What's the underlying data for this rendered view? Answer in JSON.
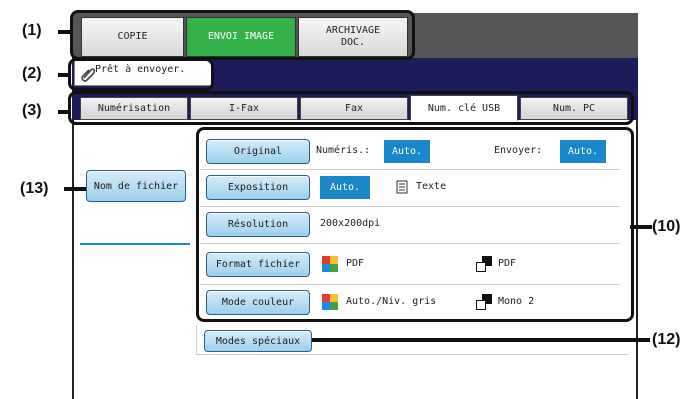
{
  "mode_tabs": [
    {
      "label": "COPIE"
    },
    {
      "label": "ENVOI IMAGE"
    },
    {
      "label": "ARCHIVAGE\nDOC."
    }
  ],
  "status": {
    "message": "Prêt à envoyer."
  },
  "sub_tabs": [
    {
      "label": "Numérisation"
    },
    {
      "label": "I-Fax"
    },
    {
      "label": "Fax"
    },
    {
      "label": "Num. clé USB"
    },
    {
      "label": "Num. PC"
    }
  ],
  "left": {
    "filename_button": "Nom de fichier"
  },
  "settings": {
    "original": {
      "button": "Original",
      "scan_label": "Numéris.:",
      "scan_value": "Auto.",
      "send_label": "Envoyer:",
      "send_value": "Auto."
    },
    "exposure": {
      "button": "Exposition",
      "value": "Auto.",
      "mode": "Texte"
    },
    "resolution": {
      "button": "Résolution",
      "value": "200x200dpi"
    },
    "file_format": {
      "button": "Format fichier",
      "color_value": "PDF",
      "mono_value": "PDF"
    },
    "color_mode": {
      "button": "Mode couleur",
      "color_value": "Auto./Niv. gris",
      "mono_value": "Mono 2"
    }
  },
  "special_modes_button": "Modes spéciaux",
  "callouts": {
    "c1": "(1)",
    "c2": "(2)",
    "c3": "(3)",
    "c13": "(13)",
    "c10": "(10)",
    "c12": "(12)"
  },
  "colors": {
    "active_mode_tab": "#33b24a",
    "status_bar": "#1c1c5a",
    "selected_value": "#1a88c8",
    "button": "#9bd0ee"
  }
}
